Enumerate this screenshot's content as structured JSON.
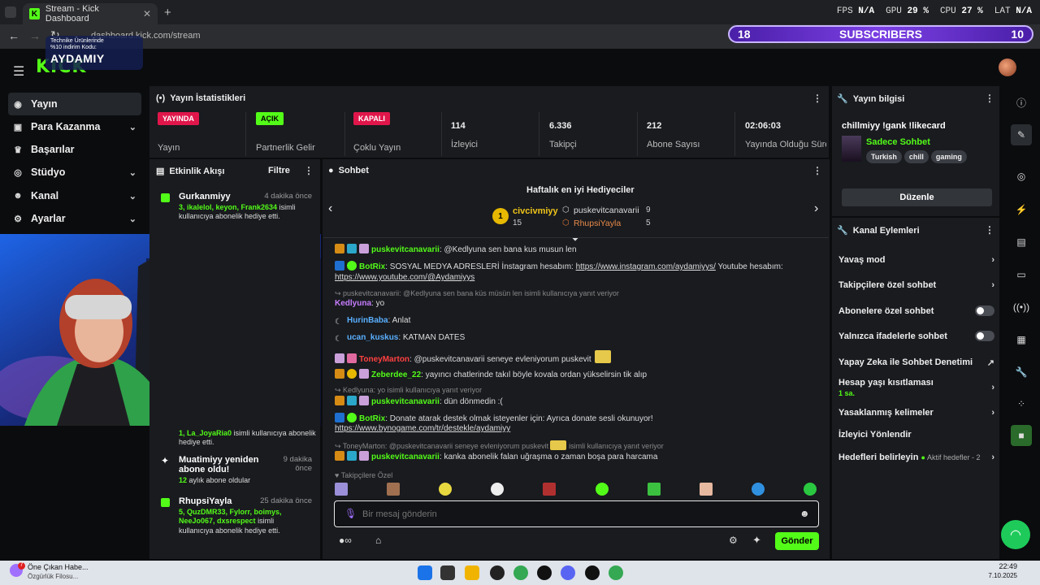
{
  "browser": {
    "tab_title": "Stream - Kick Dashboard",
    "url": "dashboard.kick.com/stream",
    "perf": {
      "fps_label": "FPS",
      "fps": "N/A",
      "gpu_label": "GPU",
      "gpu": "29 %",
      "cpu_label": "CPU",
      "cpu": "27 %",
      "lat_label": "LAT",
      "lat": "N/A"
    }
  },
  "overlay": {
    "subs_left": "18",
    "subs_label": "SUBSCRIBERS",
    "subs_right": "10",
    "promo_line1": "Technike Ürünlerinde",
    "promo_line2": "%10 indirim Kodu:",
    "promo_code": "AYDAMIY"
  },
  "site": {
    "logo": "KICK"
  },
  "sidebar": {
    "items": [
      {
        "label": "Yayın",
        "icon": "broadcast-icon"
      },
      {
        "label": "Para Kazanma",
        "icon": "money-icon"
      },
      {
        "label": "Başarılar",
        "icon": "trophy-icon"
      },
      {
        "label": "Stüdyo",
        "icon": "studio-icon"
      },
      {
        "label": "Kanal",
        "icon": "people-icon"
      },
      {
        "label": "Ayarlar",
        "icon": "gear-icon"
      }
    ]
  },
  "stats": {
    "title": "Yayın İstatistikleri",
    "items": [
      {
        "badge": "YAYINDA",
        "badge_color": "#e0164a",
        "label": "Yayın"
      },
      {
        "badge": "AÇIK",
        "badge_color": "#53fc18",
        "label": "Partnerlik Gelir"
      },
      {
        "badge": "KAPALI",
        "badge_color": "#e0164a",
        "label": "Çoklu Yayın"
      },
      {
        "value": "114",
        "label": "İzleyici"
      },
      {
        "value": "6.336",
        "label": "Takipçi"
      },
      {
        "value": "212",
        "label": "Abone Sayısı"
      },
      {
        "value": "02:06:03",
        "label": "Yayında Olduğu Süre"
      }
    ]
  },
  "feed": {
    "title": "Etkinlik Akışı",
    "filter": "Filtre",
    "items": [
      {
        "name": "Gurkanmiyy",
        "time": "4 dakika önce",
        "hl": "3, ikalelol, keyon, Frank2634",
        "desc": "isimli kullanıcıya abonelik hediye etti."
      },
      {
        "name": "",
        "time": "",
        "hl": "1, La_JoyaRia0",
        "desc": "isimli kullanıcıya abonelik hediye etti."
      },
      {
        "name": "Muatimiyy yeniden abone oldu!",
        "time": "9 dakika önce",
        "hl": "12",
        "desc": "aylık abone oldular"
      },
      {
        "name": "RhupsiYayla",
        "time": "25 dakika önce",
        "hl": "5, QuzDMR33, Fylorr, boimys, NeeJo067, dxsrespect",
        "desc": "isimli kullanıcıya abonelik hediye etti."
      }
    ]
  },
  "chat": {
    "title": "Sohbet",
    "gifters_title": "Haftalık en iyi Hediyeciler",
    "gifters": [
      {
        "rank": "1",
        "name": "civcivmiyy",
        "count": "15"
      },
      {
        "rank": "2",
        "name": "puskevitcanavarii",
        "count": "9"
      },
      {
        "rank": "3",
        "name": "RhupsiYayla",
        "count": "5"
      }
    ],
    "messages": [
      {
        "user": "puskevitcanavarii",
        "text": ": @Kedlyuna sen bana kus musun len"
      },
      {
        "user": "BotRix",
        "text": ": SOSYAL MEDYA ADRESLERİ İnstagram hesabım: ",
        "link": "https://www.instagram.com/aydamiyys/",
        "after": " Youtube hesabım:",
        "link2": "https://www.youtube.com/@Aydamiyys"
      },
      {
        "reply": "puskevitcanavarii: @Kedlyuna sen bana küs müsün len isimli kullanıcıya yanıt veriyor"
      },
      {
        "user": "Kedlyuna",
        "text": ": yo"
      },
      {
        "user": "HurinBaba",
        "text": ": Anlat"
      },
      {
        "user": "ucan_kuskus",
        "text": ": KATMAN DATES"
      },
      {
        "user": "ToneyMarton",
        "text": ": @puskevitcanavarii seneye evleniyorum puskevit"
      },
      {
        "user": "Zeberdee_22",
        "text": ": yayıncı chatlerinde takıl böyle kovala ordan yükselirsin tik alıp"
      },
      {
        "reply": "Kedlyuna: yo isimli kullanıcıya yanıt veriyor"
      },
      {
        "user": "puskevitcanavarii",
        "text": ": dün dönmedin :("
      },
      {
        "user": "BotRix",
        "text": ": Donate atarak destek olmak isteyenler için: Ayrıca donate sesli okunuyor!",
        "link": "https://www.bynogame.com/tr/destekle/aydamiyy"
      },
      {
        "reply": "ToneyMarton: @puskevitcanavarii seneye evleniyorum puskevit",
        "reply2": "isimli kullanıcıya yanıt veriyor"
      },
      {
        "user": "puskevitcanavarii",
        "text": ": kanka abonelik falan uğraşma o zaman boşa para harcama"
      }
    ],
    "follower_only": "Takipçilere Özel",
    "input_placeholder": "Bir mesaj gönderin",
    "send_label": "Gönder"
  },
  "stream_info": {
    "title": "Yayın bilgisi",
    "stream_title": "chillmiyy !gank !likecard",
    "category": "Sadece Sohbet",
    "tags": [
      "Turkish",
      "chill",
      "gaming"
    ],
    "edit_label": "Düzenle"
  },
  "channel_actions": {
    "title": "Kanal Eylemleri",
    "items": [
      {
        "label": "Yavaş mod",
        "control": "chevron"
      },
      {
        "label": "Takipçilere özel sohbet",
        "control": "chevron"
      },
      {
        "label": "Abonelere özel sohbet",
        "control": "toggle"
      },
      {
        "label": "Yalnızca ifadelerle sohbet",
        "control": "toggle"
      },
      {
        "label": "Yapay Zeka ile Sohbet Denetimi",
        "control": "external"
      },
      {
        "label": "Hesap yaşı kısıtlaması",
        "sub": "1 sa.",
        "control": "chevron"
      },
      {
        "label": "Yasaklanmış kelimeler",
        "control": "chevron"
      },
      {
        "label": "İzleyici Yönlendir",
        "control": "none"
      },
      {
        "label": "Hedefleri belirleyin",
        "sub": "Aktif hedefler - 2",
        "control": "chevron"
      }
    ]
  },
  "taskbar": {
    "news_title": "Öne Çıkan Habe...",
    "news_sub": "Özgürlük Filosu...",
    "news_badge": "7",
    "time": "22:49",
    "date": "7.10.2025"
  },
  "colors": {
    "accent": "#53fc18",
    "live": "#e0164a",
    "panel": "#191b1f",
    "bg": "#0b0c0e"
  }
}
